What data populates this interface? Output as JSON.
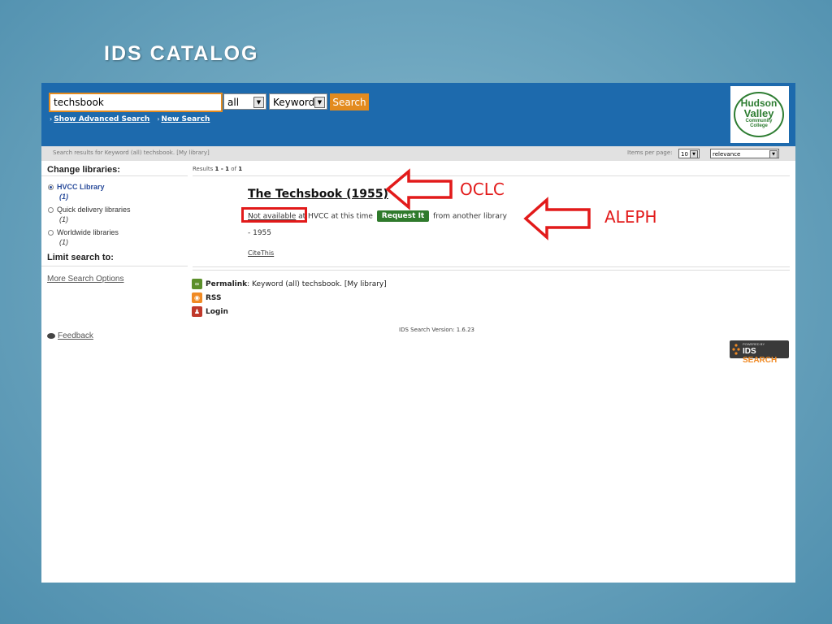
{
  "slide": {
    "title": "IDS  CATALOG"
  },
  "header": {
    "search_value": "techsbook",
    "scope_select": "all",
    "type_select": "Keyword",
    "search_button": "Search",
    "links": [
      "Show Advanced Search",
      "New Search"
    ],
    "logo": {
      "line1": "Hudson",
      "line2": "Valley",
      "line3": "Community",
      "line4": "College"
    }
  },
  "infobar": {
    "summary_prefix": "Search results for Keyword (all) techsbook.",
    "my_library": "[My library]",
    "items_per_page_label": "Items per page:",
    "items_per_page": "10",
    "sort": "relevance"
  },
  "sidebar": {
    "change_libraries": "Change libraries:",
    "libraries": [
      {
        "label": "HVCC Library",
        "count": "(1)",
        "selected": true
      },
      {
        "label": "Quick delivery libraries",
        "count": "(1)",
        "selected": false
      },
      {
        "label": "Worldwide libraries",
        "count": "(1)",
        "selected": false
      }
    ],
    "limit_search": "Limit search to:",
    "more_options": "More Search Options",
    "feedback": "Feedback"
  },
  "results": {
    "label_prefix": "Results",
    "range": "1 - 1",
    "of": "of",
    "total": "1",
    "item": {
      "title": "The Techsbook (1955)",
      "not_available": "Not available",
      "at_text": "at HVCC at this time",
      "request_button": "Request It",
      "from_text": "from another library",
      "year": "- 1955",
      "cite": "CiteThis"
    }
  },
  "footer": {
    "permalink_label": "Permalink",
    "permalink_text": ": Keyword (all) techsbook. [My library]",
    "rss": "RSS",
    "login": "Login",
    "version": "IDS Search Version: 1.6.23",
    "badge_small": "POWERED BY",
    "badge_ids": "IDS",
    "badge_search": "SEARCH"
  },
  "annotations": {
    "oclc": "OCLC",
    "aleph": "ALEPH"
  },
  "colors": {
    "header_bg": "#1d6aad",
    "accent_orange": "#e38b1f",
    "annotation_red": "#e21a1a",
    "request_green": "#2f7a2c"
  }
}
